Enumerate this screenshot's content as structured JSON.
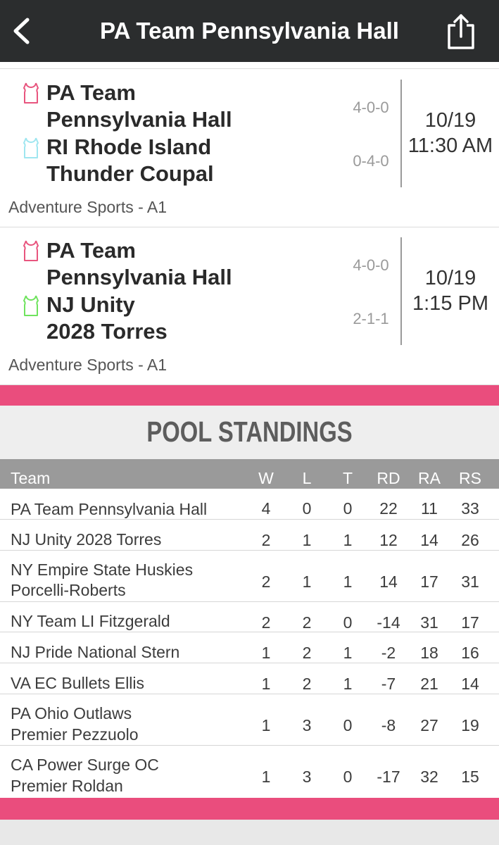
{
  "header": {
    "title": "PA Team Pennsylvania Hall"
  },
  "games": [
    {
      "team1": [
        "PA Team",
        "Pennsylvania Hall"
      ],
      "team1_record": "4-0-0",
      "team1_color": "#e8557e",
      "team2": [
        "RI Rhode Island",
        "Thunder Coupal"
      ],
      "team2_record": "0-4-0",
      "team2_color": "#9fe6f0",
      "date": "10/19",
      "time": "11:30 AM",
      "venue": "Adventure Sports - A1"
    },
    {
      "team1": [
        "PA Team",
        "Pennsylvania Hall"
      ],
      "team1_record": "4-0-0",
      "team1_color": "#e8557e",
      "team2": [
        "NJ Unity",
        "2028 Torres"
      ],
      "team2_record": "2-1-1",
      "team2_color": "#6fe35e",
      "date": "10/19",
      "time": "1:15 PM",
      "venue": "Adventure Sports - A1"
    }
  ],
  "standings": {
    "title": "POOL STANDINGS",
    "columns": [
      "Team",
      "W",
      "L",
      "T",
      "RD",
      "RA",
      "RS"
    ],
    "rows": [
      {
        "team": [
          "PA Team Pennsylvania Hall"
        ],
        "W": "4",
        "L": "0",
        "T": "0",
        "RD": "22",
        "RA": "11",
        "RS": "33"
      },
      {
        "team": [
          "NJ Unity 2028 Torres"
        ],
        "W": "2",
        "L": "1",
        "T": "1",
        "RD": "12",
        "RA": "14",
        "RS": "26"
      },
      {
        "team": [
          "NY Empire State Huskies",
          "Porcelli-Roberts"
        ],
        "W": "2",
        "L": "1",
        "T": "1",
        "RD": "14",
        "RA": "17",
        "RS": "31"
      },
      {
        "team": [
          "NY Team LI Fitzgerald"
        ],
        "W": "2",
        "L": "2",
        "T": "0",
        "RD": "-14",
        "RA": "31",
        "RS": "17"
      },
      {
        "team": [
          "NJ Pride National Stern"
        ],
        "W": "1",
        "L": "2",
        "T": "1",
        "RD": "-2",
        "RA": "18",
        "RS": "16"
      },
      {
        "team": [
          "VA EC Bullets Ellis"
        ],
        "W": "1",
        "L": "2",
        "T": "1",
        "RD": "-7",
        "RA": "21",
        "RS": "14"
      },
      {
        "team": [
          "PA Ohio Outlaws",
          "Premier Pezzuolo"
        ],
        "W": "1",
        "L": "3",
        "T": "0",
        "RD": "-8",
        "RA": "27",
        "RS": "19"
      },
      {
        "team": [
          "CA Power Surge OC",
          "Premier Roldan"
        ],
        "W": "1",
        "L": "3",
        "T": "0",
        "RD": "-17",
        "RA": "32",
        "RS": "15"
      }
    ]
  },
  "colors": {
    "accent": "#ea4d7d",
    "header_bg": "#2b2d2e",
    "table_head_bg": "#9a9a9a"
  }
}
